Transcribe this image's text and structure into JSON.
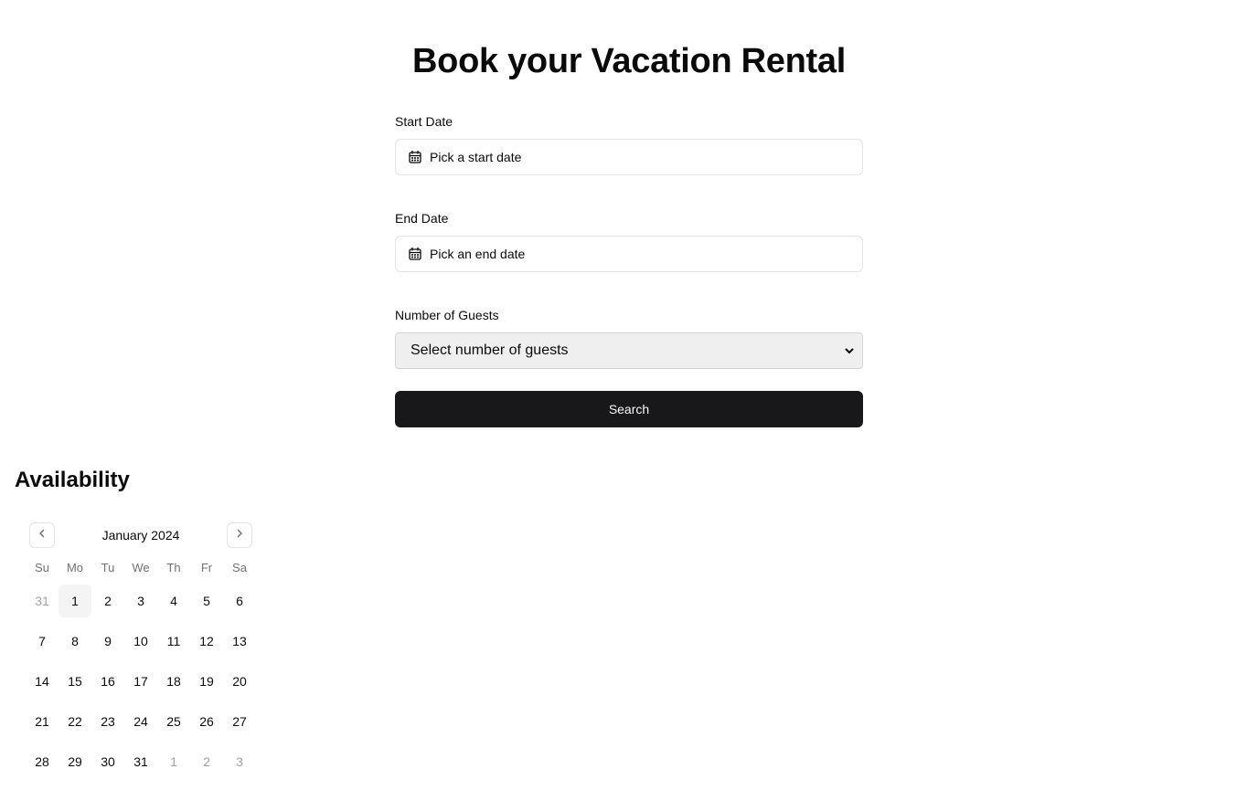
{
  "title": "Book your Vacation Rental",
  "form": {
    "start_label": "Start Date",
    "start_placeholder": "Pick a start date",
    "end_label": "End Date",
    "end_placeholder": "Pick an end date",
    "guests_label": "Number of Guests",
    "guests_selected": "Select number of guests",
    "search_label": "Search"
  },
  "availability": {
    "title": "Availability",
    "month": "January 2024",
    "weekdays": [
      "Su",
      "Mo",
      "Tu",
      "We",
      "Th",
      "Fr",
      "Sa"
    ],
    "weeks": [
      [
        "31",
        "1",
        "2",
        "3",
        "4",
        "5",
        "6"
      ],
      [
        "7",
        "8",
        "9",
        "10",
        "11",
        "12",
        "13"
      ],
      [
        "14",
        "15",
        "16",
        "17",
        "18",
        "19",
        "20"
      ],
      [
        "21",
        "22",
        "23",
        "24",
        "25",
        "26",
        "27"
      ],
      [
        "28",
        "29",
        "30",
        "31",
        "1",
        "2",
        "3"
      ]
    ]
  },
  "colors": {
    "primary": "#18181b",
    "border": "#e4e4e7",
    "muted_text": "#71717a",
    "outside_day": "#a1a1aa",
    "today_bg": "#f4f4f5"
  },
  "icons": {
    "date_field": "calendar-icon",
    "prev": "chevron-left-icon",
    "next": "chevron-right-icon",
    "select": "chevron-down-icon"
  }
}
